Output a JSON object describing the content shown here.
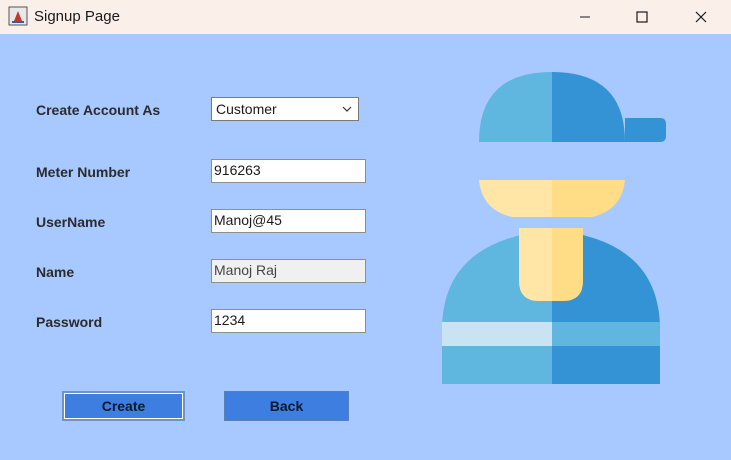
{
  "window": {
    "title": "Signup Page",
    "icons": {
      "app": "java-app-icon",
      "minimize": "minimize-icon",
      "maximize": "maximize-icon",
      "close": "close-icon"
    }
  },
  "form": {
    "account_type": {
      "label": "Create Account As",
      "selected": "Customer"
    },
    "meter_number": {
      "label": "Meter Number",
      "value": "916263"
    },
    "username": {
      "label": "UserName",
      "value": "Manoj@45"
    },
    "name": {
      "label": "Name",
      "value": "Manoj Raj"
    },
    "password": {
      "label": "Password",
      "value": "1234"
    }
  },
  "buttons": {
    "create": "Create",
    "back": "Back"
  },
  "colors": {
    "background": "#a8c9ff",
    "button": "#3e7ee0",
    "titlebar": "#fbefe9"
  },
  "illustration": "user-avatar-icon"
}
